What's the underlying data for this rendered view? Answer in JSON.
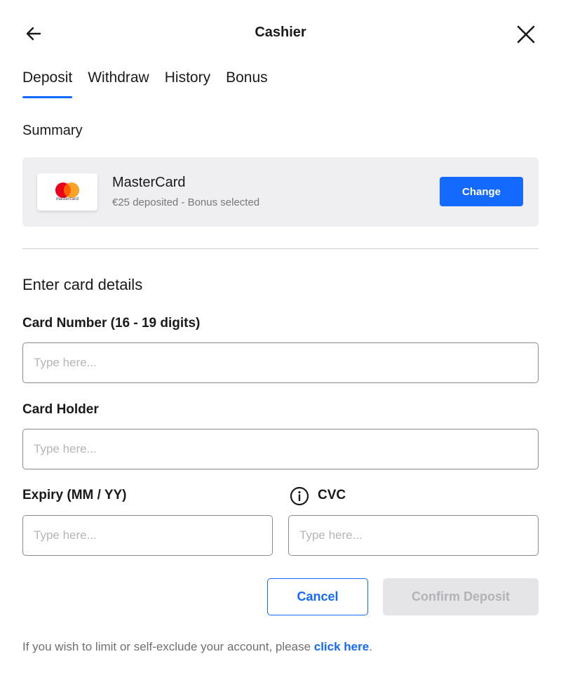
{
  "header": {
    "title": "Cashier",
    "back_icon": "arrow-left-icon",
    "close_icon": "close-icon"
  },
  "tabs": [
    {
      "label": "Deposit",
      "active": true
    },
    {
      "label": "Withdraw",
      "active": false
    },
    {
      "label": "History",
      "active": false
    },
    {
      "label": "Bonus",
      "active": false
    }
  ],
  "summary": {
    "title": "Summary",
    "card_brand": "MasterCard",
    "card_logo_text": "mastercard",
    "status_text": "€25 deposited - Bonus selected",
    "change_label": "Change"
  },
  "form": {
    "title": "Enter card details",
    "card_number": {
      "label": "Card Number (16 - 19 digits)",
      "placeholder": "Type here...",
      "value": ""
    },
    "card_holder": {
      "label": "Card Holder",
      "placeholder": "Type here...",
      "value": ""
    },
    "expiry": {
      "label": "Expiry (MM / YY)",
      "placeholder": "Type here...",
      "value": ""
    },
    "cvc": {
      "label": "CVC",
      "placeholder": "Type here...",
      "value": ""
    }
  },
  "actions": {
    "cancel_label": "Cancel",
    "confirm_label": "Confirm Deposit"
  },
  "footer": {
    "text": "If you wish to limit or self-exclude your account, please ",
    "link_label": "click here",
    "suffix": "."
  },
  "colors": {
    "accent": "#1469ff",
    "summary_bg": "#efeff1",
    "disabled_bg": "#e5e5e7",
    "mastercard_red": "#eb001b",
    "mastercard_orange": "#f79e1b"
  }
}
